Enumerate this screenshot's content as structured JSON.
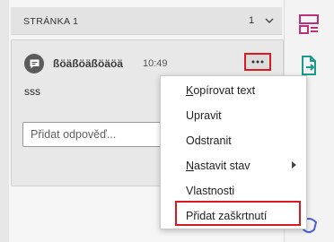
{
  "page": {
    "title": "STRÁNKA 1",
    "count": "1"
  },
  "comment": {
    "author": "ßöäßöäßöäöä",
    "time": "10:49",
    "text": "sss",
    "reply_placeholder": "Přidat odpověď..."
  },
  "menu": {
    "items": [
      {
        "first": "K",
        "rest": "opírovat text"
      },
      {
        "first": "",
        "rest": "Upravit"
      },
      {
        "first": "",
        "rest": "Odstranit"
      },
      {
        "first": "N",
        "rest": "astavit stav"
      },
      {
        "first": "",
        "rest": "Vlastnosti"
      },
      {
        "first": "",
        "rest": "Přidat zaškrtnutí"
      }
    ]
  },
  "icons": {
    "more": "more-options-icon",
    "avatar": "comment-icon",
    "chevron": "chevron-down-icon",
    "tools": [
      "organize-pages-icon",
      "export-pdf-icon",
      "edit-pdf-icon"
    ]
  },
  "colors": {
    "highlight": "#d71920",
    "tool_pink": "#c0307a",
    "tool_teal": "#1a9a8a",
    "tool_blue": "#4a5fd6"
  }
}
